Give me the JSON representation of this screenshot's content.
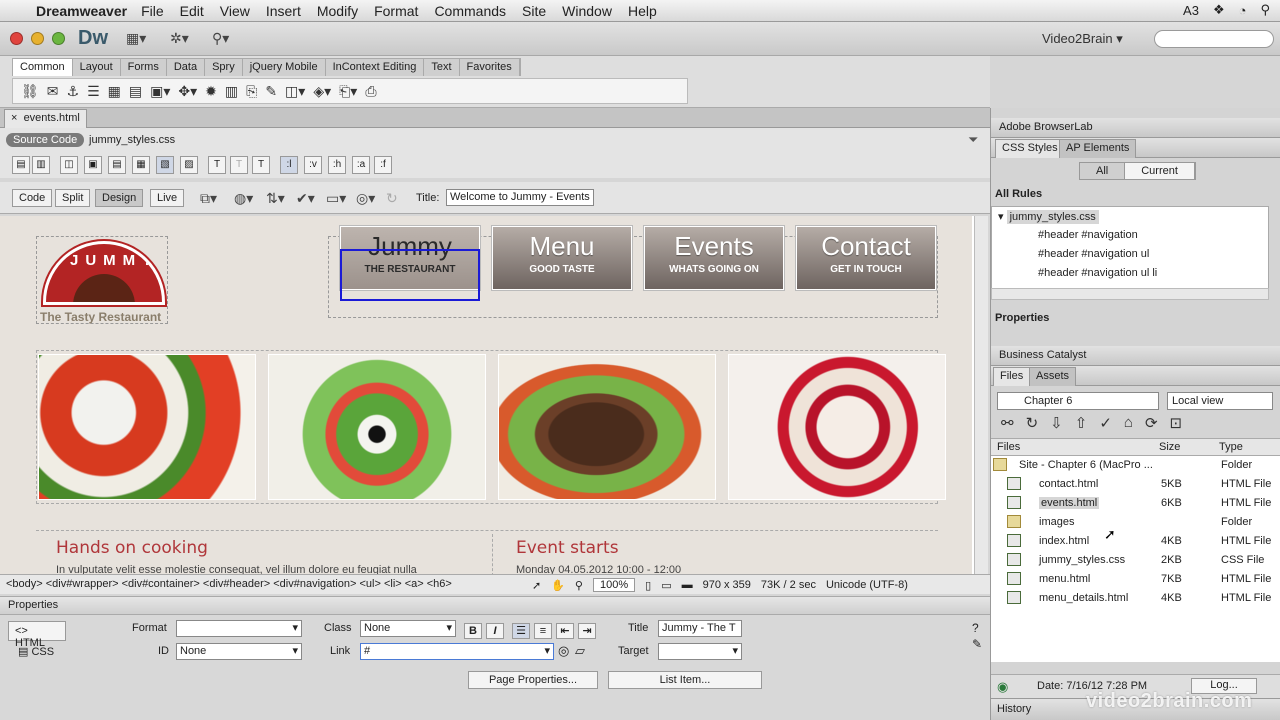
{
  "menubar": {
    "app": "Dreamweaver",
    "items": [
      "File",
      "Edit",
      "View",
      "Insert",
      "Modify",
      "Format",
      "Commands",
      "Site",
      "Window",
      "Help"
    ],
    "adobe_badge": "3"
  },
  "app": {
    "logo": "Dw",
    "site_name": "Video2Brain",
    "search_placeholder": ""
  },
  "insert": {
    "tabs": [
      "Common",
      "Layout",
      "Forms",
      "Data",
      "Spry",
      "jQuery Mobile",
      "InContext Editing",
      "Text",
      "Favorites"
    ],
    "active_tab": "Common"
  },
  "document": {
    "tab": "events.html",
    "source_code": "Source Code",
    "related_file": "jummy_styles.css",
    "view_buttons": [
      "Code",
      "Split",
      "Design",
      "Live"
    ],
    "active_view": "Design",
    "title_label": "Title:",
    "title_value": "Welcome to Jummy - Events"
  },
  "page": {
    "logo_word": "JUMMY",
    "tagline": "The Tasty Restaurant",
    "nav": [
      {
        "big": "Jummy",
        "small": "THE RESTAURANT"
      },
      {
        "big": "Menu",
        "small": "GOOD TASTE"
      },
      {
        "big": "Events",
        "small": "WHATS GOING ON"
      },
      {
        "big": "Contact",
        "small": "GET IN TOUCH"
      }
    ],
    "left_title": "Hands on cooking",
    "left_body": "In vulputate velit esse molestie consequat, vel illum dolore eu feugiat nulla",
    "right_title": "Event starts",
    "right_body": "Monday 04.05.2012     10:00 - 12:00"
  },
  "status": {
    "tag_selector": "<body> <div#wrapper> <div#container> <div#header> <div#navigation> <ul> <li> <a> <h6>",
    "zoom": "100%",
    "dimensions": "970 x 359",
    "download": "73K / 2 sec",
    "encoding": "Unicode (UTF-8)"
  },
  "properties": {
    "header": "Properties",
    "html_label": "HTML",
    "css_label": "CSS",
    "format_label": "Format",
    "format_value": "",
    "id_label": "ID",
    "id_value": "None",
    "class_label": "Class",
    "class_value": "None",
    "link_label": "Link",
    "link_value": "#",
    "title_label": "Title",
    "title_value": "Jummy - The T",
    "target_label": "Target",
    "target_value": "",
    "page_properties_button": "Page Properties...",
    "list_item_button": "List Item..."
  },
  "panels": {
    "browserlab": "Adobe BrowserLab",
    "css_styles_tab": "CSS Styles",
    "ap_elements_tab": "AP Elements",
    "all_label": "All",
    "current_label": "Current",
    "all_rules": "All Rules",
    "rules": [
      "jummy_styles.css",
      "#header #navigation",
      "#header #navigation ul",
      "#header #navigation ul li"
    ],
    "properties_label": "Properties",
    "business_catalyst": "Business Catalyst",
    "files_tab": "Files",
    "assets_tab": "Assets",
    "site_dropdown": "Chapter 6",
    "view_dropdown": "Local view",
    "col_files": "Files",
    "col_size": "Size",
    "col_type": "Type",
    "files": [
      {
        "name": "Site - Chapter 6 (MacPro ...",
        "size": "",
        "type": "Folder",
        "kind": "folder"
      },
      {
        "name": "contact.html",
        "size": "5KB",
        "type": "HTML File",
        "kind": "file"
      },
      {
        "name": "events.html",
        "size": "6KB",
        "type": "HTML File",
        "kind": "file"
      },
      {
        "name": "images",
        "size": "",
        "type": "Folder",
        "kind": "folder"
      },
      {
        "name": "index.html",
        "size": "4KB",
        "type": "HTML File",
        "kind": "file"
      },
      {
        "name": "jummy_styles.css",
        "size": "2KB",
        "type": "CSS File",
        "kind": "file"
      },
      {
        "name": "menu.html",
        "size": "7KB",
        "type": "HTML File",
        "kind": "file"
      },
      {
        "name": "menu_details.html",
        "size": "4KB",
        "type": "HTML File",
        "kind": "file"
      }
    ],
    "footer_date": "Date: 7/16/12 7:28 PM",
    "log_button": "Log...",
    "history": "History"
  },
  "watermark": "video2brain.com",
  "colors": {
    "accent_red": "#b32424",
    "heading_red": "#b0363a",
    "selection_blue": "#1a1ad6"
  }
}
